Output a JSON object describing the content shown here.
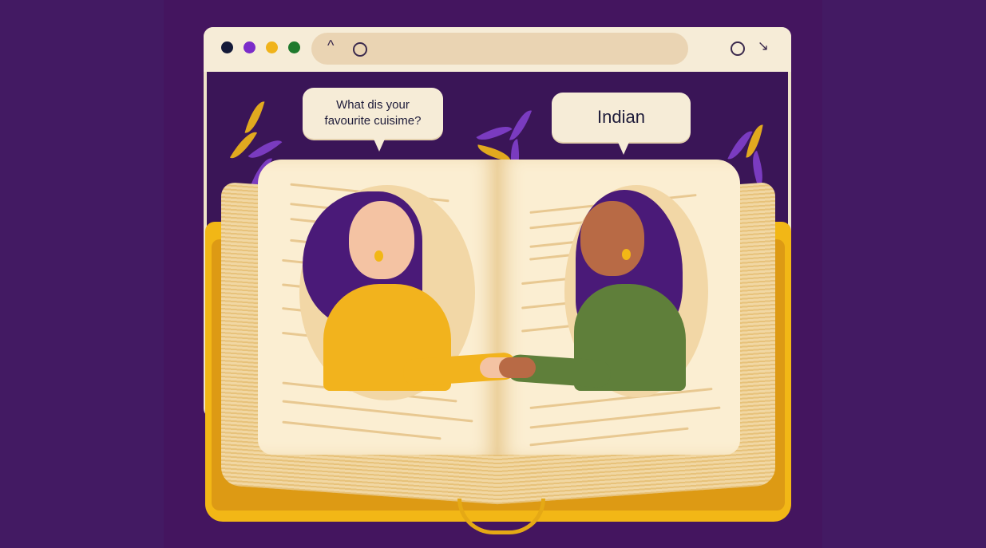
{
  "speech": {
    "question": "What dis your\nfavourite cuisime?",
    "question_line1": "What dis your",
    "question_line2": "favourite cuisime?",
    "answer": "Indian"
  },
  "browser": {
    "dots": [
      "#141a38",
      "#7b2cc9",
      "#f0b31b",
      "#1f7a2d"
    ],
    "icons": [
      "chevron-up-icon",
      "circle-icon",
      "circle-icon",
      "arrow-diagonal-icon"
    ]
  },
  "colors": {
    "background": "#44155f",
    "book_cover": "#f2b716",
    "page": "#fbeed2",
    "left_shirt": "#f2b31d",
    "right_shirt": "#5f7f3a",
    "hair": "#4a1a78",
    "leaf_purple": "#7a3bc0",
    "leaf_gold": "#e1a91f"
  }
}
